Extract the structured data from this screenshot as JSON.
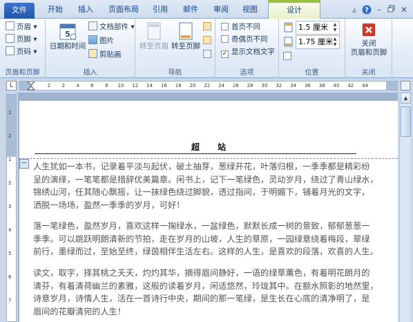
{
  "tabs": [
    {
      "label": "文件"
    },
    {
      "label": "开始"
    },
    {
      "label": "插入"
    },
    {
      "label": "页面布局"
    },
    {
      "label": "引用"
    },
    {
      "label": "邮件"
    },
    {
      "label": "审阅"
    },
    {
      "label": "视图"
    },
    {
      "label": "设计"
    }
  ],
  "ribbon": {
    "groups": {
      "header_footer": {
        "label": "页眉和页脚",
        "header": "页眉",
        "footer": "页脚",
        "page_number": "页码"
      },
      "insert": {
        "label": "插入",
        "date_time": "日期和时间",
        "doc_parts": "文档部件",
        "picture": "图片",
        "clip_art": "剪贴画"
      },
      "navigation": {
        "label": "导航",
        "goto_header": "转至页眉",
        "goto_footer": "转至页脚"
      },
      "options": {
        "label": "选项",
        "diff_first": "首页不同",
        "diff_odd_even": "奇偶页不同",
        "show_doc_text": "显示文档文字",
        "show_doc_text_checked": true
      },
      "position": {
        "label": "位置",
        "header_pos": "1.5 厘米",
        "footer_pos": "1.75 厘米"
      },
      "close": {
        "label": "关闭",
        "close_btn_line1": "关闭",
        "close_btn_line2": "页眉和页脚"
      }
    }
  },
  "ruler": {
    "corner": "L",
    "numbers": [
      "2",
      "2",
      "4",
      "6",
      "8",
      "10",
      "12",
      "14",
      "16",
      "18",
      "20",
      "22",
      "24",
      "26",
      "28",
      "30",
      "32",
      "34",
      "36",
      "38",
      "40",
      "42",
      "44"
    ]
  },
  "document": {
    "header_text": "超站",
    "header_tag": "一",
    "paragraphs": [
      [
        "人生犹如一本书，记录着平淡与起伏，破土抽芽，葱绿开花，叶落归根，一季季都是精彩纷",
        "呈的演绎，一笔笔都是措辞优美篇章。闲书上，记下一笔绿色，灵动岁月，绕过了青山绿水，",
        "锦绣山河，任其随心飘摇，让一抹绿色绕过脚貌，透过指间，于明媚下，铺着月光的文字，",
        "洒脱一场场，盈然一季季的岁月，可好！"
      ],
      [
        "落一笔绿色，盈然岁月，喜欢这样一掬绿水，一盆绿色，默默长成一树的景致，郁郁葱葱一",
        "季季。可以跳跃明朗清新的节拍，走在岁月的山坡，人生的草原，一园绿意绕着梅段，翠绿",
        "前行，墨绿而过，至始至终，绿茵相伴生活左右。这样的人生，是喜欢的段落，欢喜的人生。"
      ],
      [
        "读文，取字，择其桃之夭夭，灼灼其华，摘得眉间静好，一语的绿草薰色，有着明花朗月的",
        "清芬，有着清荷幽兰的素雅，这般的读着岁月，闲适悠然，玲珑其中。在额水照影的地然里，",
        "诗意岁月，诗情人生，活在一首诗行中央，期间的那一笔绿，是生长在心底的清净明了，是",
        "眉间的花瓣清宛的人生！"
      ]
    ]
  }
}
